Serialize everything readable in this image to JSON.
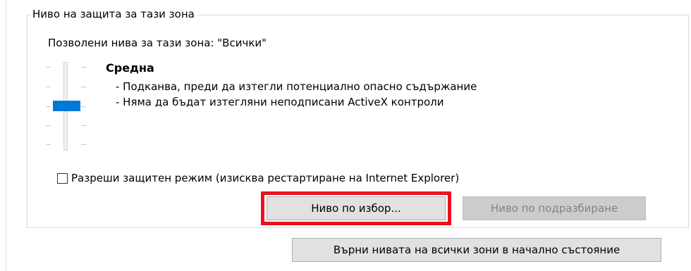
{
  "group": {
    "title": "Ниво на защита за тази зона",
    "allowed_levels": "Позволени нива за тази зона: \"Всички\""
  },
  "level": {
    "name": "Средна",
    "descriptions": [
      "- Подканва, преди да изтегли потенциално опасно съдържание",
      "- Няма да бъдат изтегляни неподписани ActiveX контроли"
    ],
    "slider_position": "3 of 5"
  },
  "protected_mode": {
    "label": "Разреши защитен режим (изисква рестартиране на Internet Explorer)",
    "checked": false
  },
  "buttons": {
    "custom_level": "Ниво по избор...",
    "default_level": "Ниво по подразбиране",
    "reset_all": "Върни нивата на всички зони в начално състояние"
  },
  "colors": {
    "accent": "#0078d7",
    "highlight": "#e8141e"
  }
}
